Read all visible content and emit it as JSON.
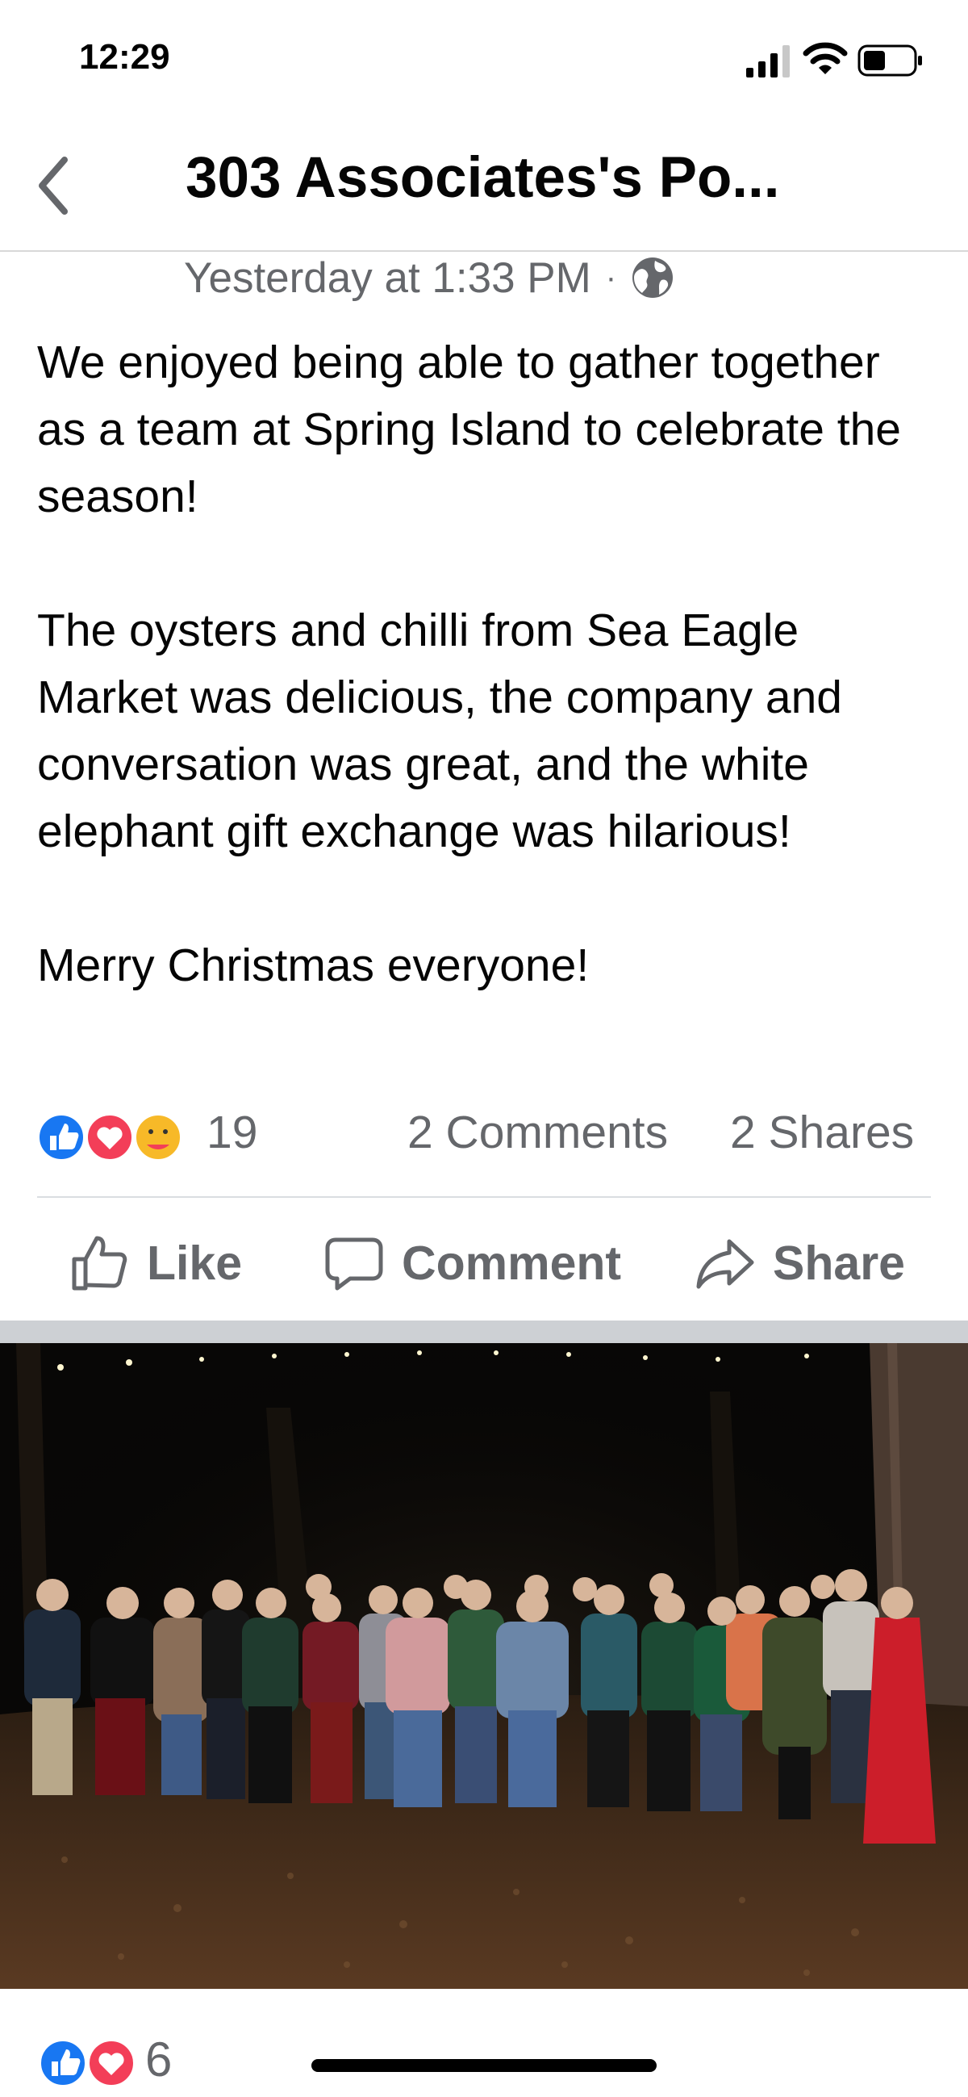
{
  "status_bar": {
    "time": "12:29"
  },
  "header": {
    "title": "303 Associates's Po..."
  },
  "post": {
    "timestamp": "Yesterday at 1:33 PM",
    "separator": "·",
    "audience_icon": "globe-icon",
    "paragraphs": [
      "We enjoyed being able to gather together as a team at Spring Island to celebrate the season!",
      "The oysters and chilli from Sea Eagle Market was delicious, the company and conversation was great, and the white elephant gift exchange was hilarious!",
      "Merry Christmas everyone!"
    ],
    "reaction_count": "19",
    "comments": "2 Comments",
    "shares": "2 Shares"
  },
  "actions": {
    "like": "Like",
    "comment": "Comment",
    "share": "Share"
  },
  "photo_reactions": {
    "count": "6"
  },
  "colors": {
    "like_blue": "#1877f2",
    "love_red": "#f33e58",
    "care_yellow": "#f7b928",
    "muted_gray": "#65676b"
  }
}
